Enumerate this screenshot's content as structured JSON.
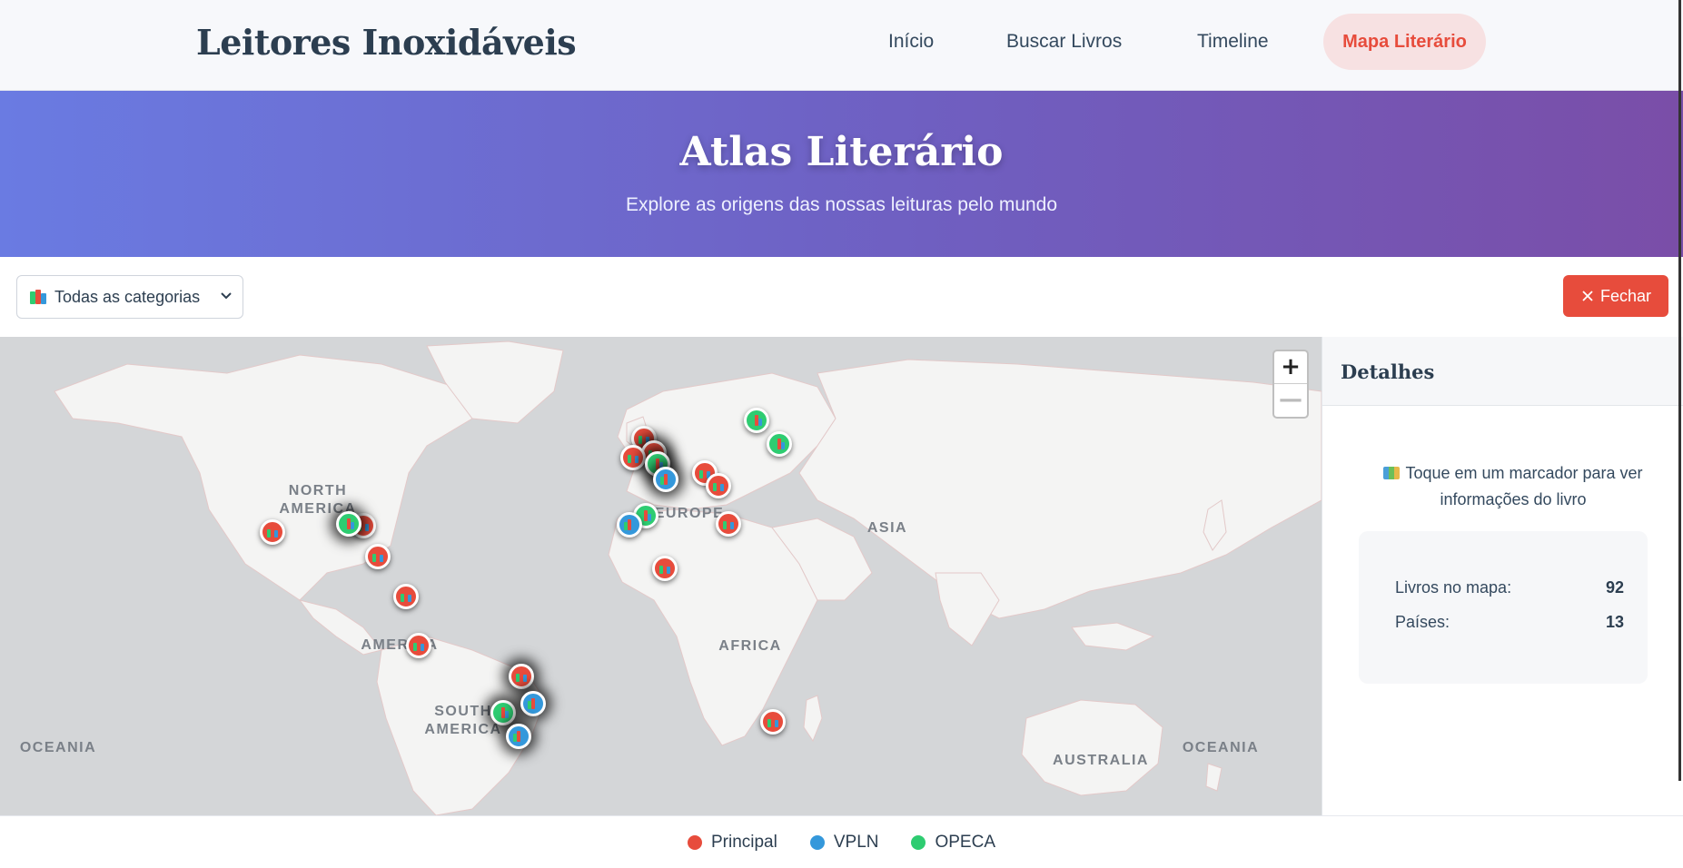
{
  "nav": {
    "brand": "Leitores Inoxidáveis",
    "links": [
      "Início",
      "Buscar Livros",
      "Timeline"
    ],
    "active": "Mapa Literário"
  },
  "hero": {
    "title": "Atlas Literário",
    "subtitle": "Explore as origens das nossas leituras pelo mundo"
  },
  "toolbar": {
    "category_select": "Todas as categorias",
    "close_label": "Fechar"
  },
  "map": {
    "labels": [
      "NORTH AMERICA",
      "SOUTH AMERICA",
      "AMERICA",
      "EUROPE",
      "AFRICA",
      "ASIA",
      "OCEANIA",
      "OCEANIA",
      "AUSTRALIA"
    ],
    "zoom_in": "+",
    "zoom_out": "—",
    "markers": [
      {
        "category": "Principal",
        "icon": "books-icon"
      },
      {
        "category": "Principal",
        "icon": "books-icon"
      },
      {
        "category": "OPECA",
        "icon": "books-icon"
      },
      {
        "category": "Principal",
        "icon": "books-icon"
      },
      {
        "category": "Principal",
        "icon": "books-icon"
      },
      {
        "category": "Principal",
        "icon": "books-icon"
      },
      {
        "category": "Principal",
        "icon": "books-icon"
      },
      {
        "category": "Principal",
        "icon": "books-icon"
      },
      {
        "category": "Principal",
        "icon": "books-icon"
      },
      {
        "category": "OPECA",
        "icon": "books-icon"
      },
      {
        "category": "VPLN",
        "icon": "books-icon"
      },
      {
        "category": "Principal",
        "icon": "books-icon"
      },
      {
        "category": "Principal",
        "icon": "books-icon"
      },
      {
        "category": "OPECA",
        "icon": "books-icon"
      },
      {
        "category": "VPLN",
        "icon": "books-icon"
      },
      {
        "category": "Principal",
        "icon": "books-icon"
      },
      {
        "category": "Principal",
        "icon": "books-icon"
      },
      {
        "category": "OPECA",
        "icon": "books-icon"
      },
      {
        "category": "OPECA",
        "icon": "books-icon"
      },
      {
        "category": "Principal",
        "icon": "books-icon"
      },
      {
        "category": "OPECA",
        "icon": "books-icon"
      },
      {
        "category": "VPLN",
        "icon": "books-icon"
      },
      {
        "category": "VPLN",
        "icon": "books-icon"
      },
      {
        "category": "Principal",
        "icon": "books-icon"
      }
    ]
  },
  "details": {
    "title": "Detalhes",
    "hint_icon": "map-icon",
    "hint": "Toque em um marcador para ver informações do livro",
    "stats": [
      {
        "label": "Livros no mapa:",
        "value": "92"
      },
      {
        "label": "Países:",
        "value": "13"
      }
    ]
  },
  "legend": [
    {
      "label": "Principal",
      "color": "#e74c3c"
    },
    {
      "label": "VPLN",
      "color": "#3498db"
    },
    {
      "label": "OPECA",
      "color": "#2ecc71"
    }
  ],
  "colors": {
    "Principal": "#e74c3c",
    "VPLN": "#3498db",
    "OPECA": "#2ecc71"
  }
}
